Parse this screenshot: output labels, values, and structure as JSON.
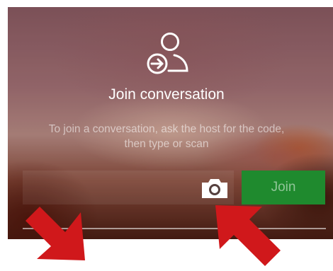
{
  "dialog": {
    "title": "Join conversation",
    "subtitle_line1": "To join a conversation, ask the host for the code,",
    "subtitle_line2": "then type or scan",
    "code_input_value": "",
    "join_label": "Join"
  },
  "icons": {
    "header": "join-conversation-icon",
    "scan": "camera-icon",
    "annotations": [
      "red-arrow",
      "red-arrow"
    ]
  },
  "colors": {
    "join_button": "#1f8a2e",
    "arrow": "#d0181b",
    "title_text": "#ffffff"
  }
}
